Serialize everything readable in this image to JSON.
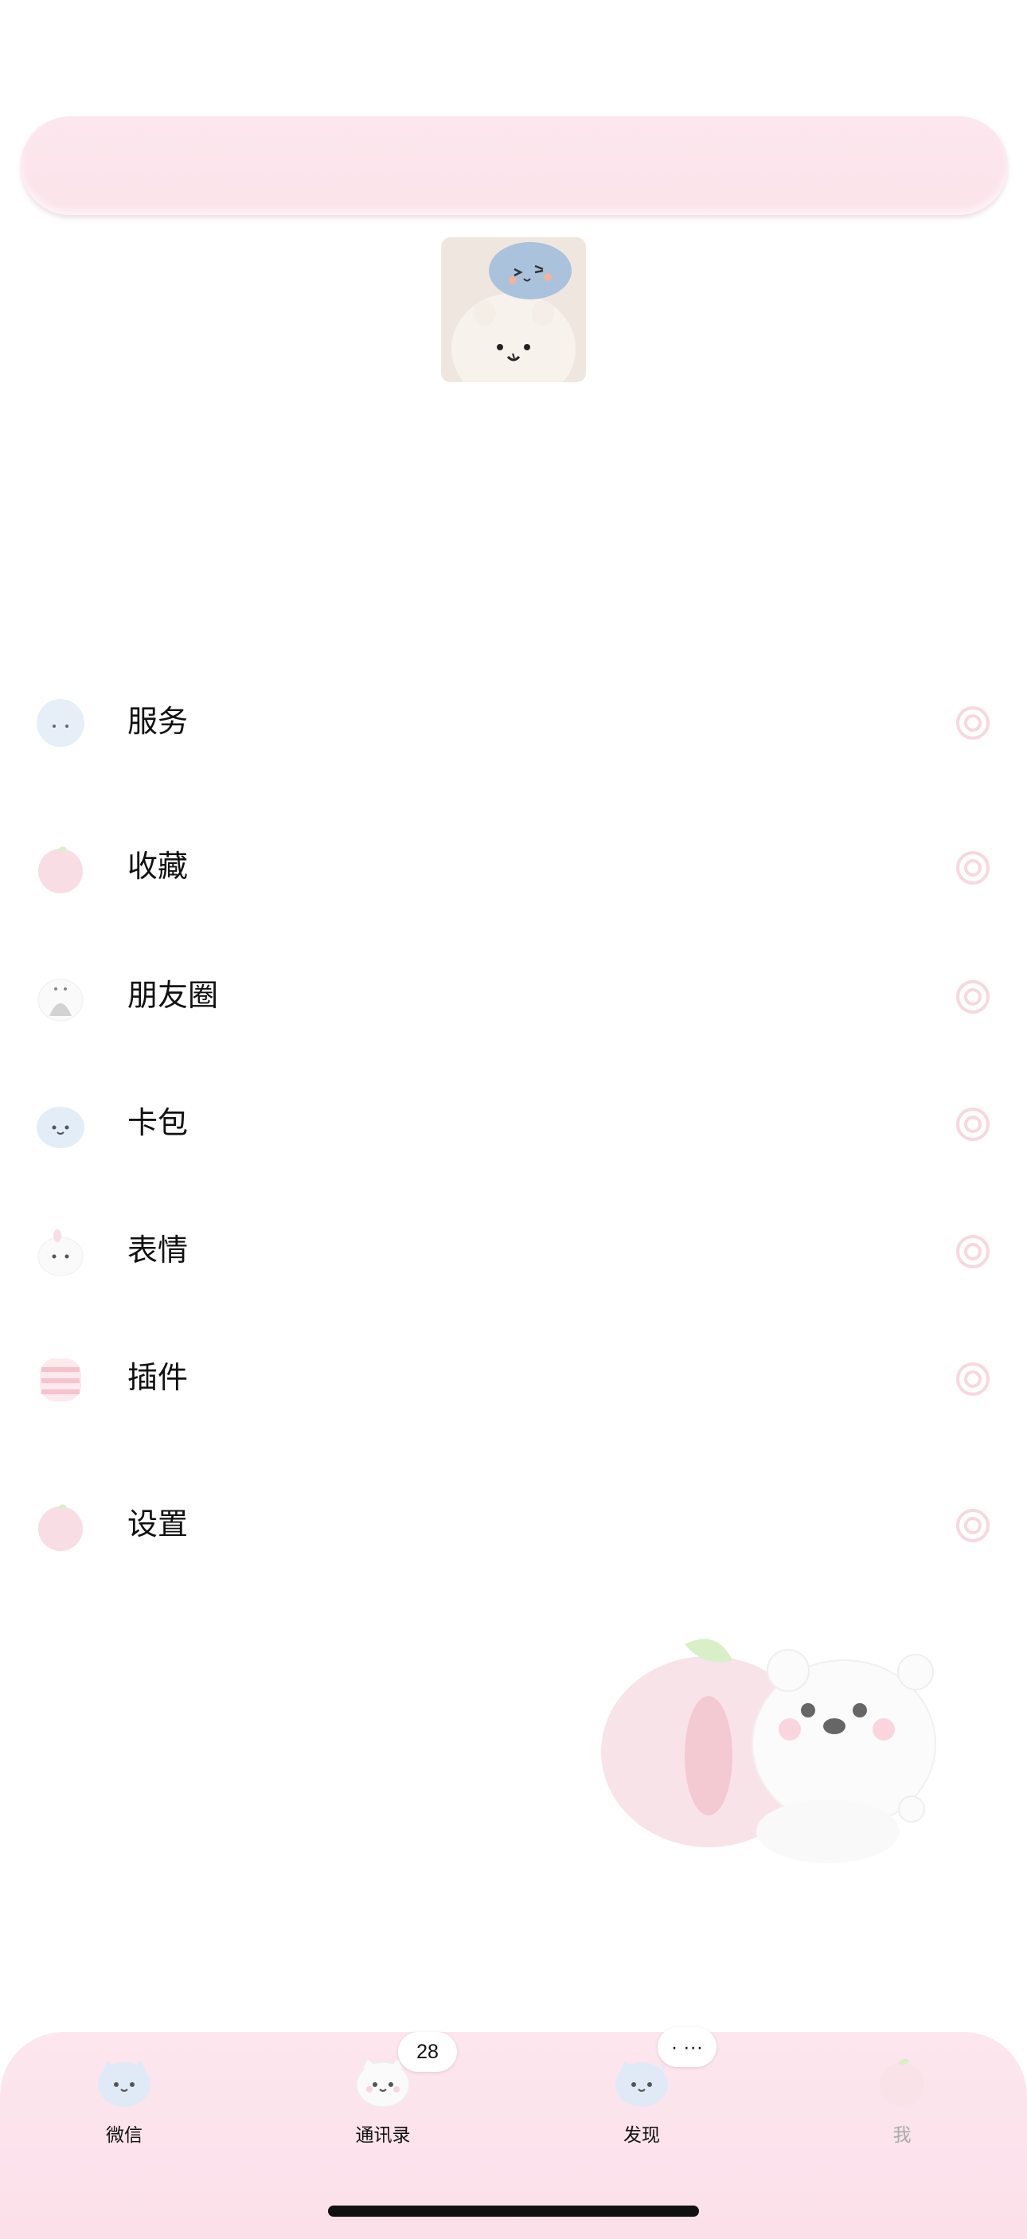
{
  "menu": [
    {
      "id": "services",
      "label": "服务",
      "icon": "cloud-cat-icon"
    },
    {
      "id": "favorites",
      "label": "收藏",
      "icon": "peach-icon"
    },
    {
      "id": "moments",
      "label": "朋友圈",
      "icon": "bunny-icon"
    },
    {
      "id": "cards",
      "label": "卡包",
      "icon": "blue-cat-icon"
    },
    {
      "id": "stickers",
      "label": "表情",
      "icon": "white-bunny-icon"
    },
    {
      "id": "plugins",
      "label": "插件",
      "icon": "striped-cup-icon"
    },
    {
      "id": "settings",
      "label": "设置",
      "icon": "peach-icon"
    }
  ],
  "tabbar": {
    "tabs": [
      {
        "label": "微信",
        "icon": "blue-cat-icon"
      },
      {
        "label": "通讯录",
        "icon": "white-cat-icon",
        "badge": "28"
      },
      {
        "label": "发现",
        "icon": "blue-cat-icon",
        "badge": "· ···"
      },
      {
        "label": "我",
        "icon": "peach-icon"
      }
    ]
  },
  "colors": {
    "banner": "#fde7ee",
    "tabbar": "#fde6ee",
    "arrow": "#f6d3dc",
    "peach": "#f6c3cc",
    "blue_cat": "#dfeaf6"
  }
}
